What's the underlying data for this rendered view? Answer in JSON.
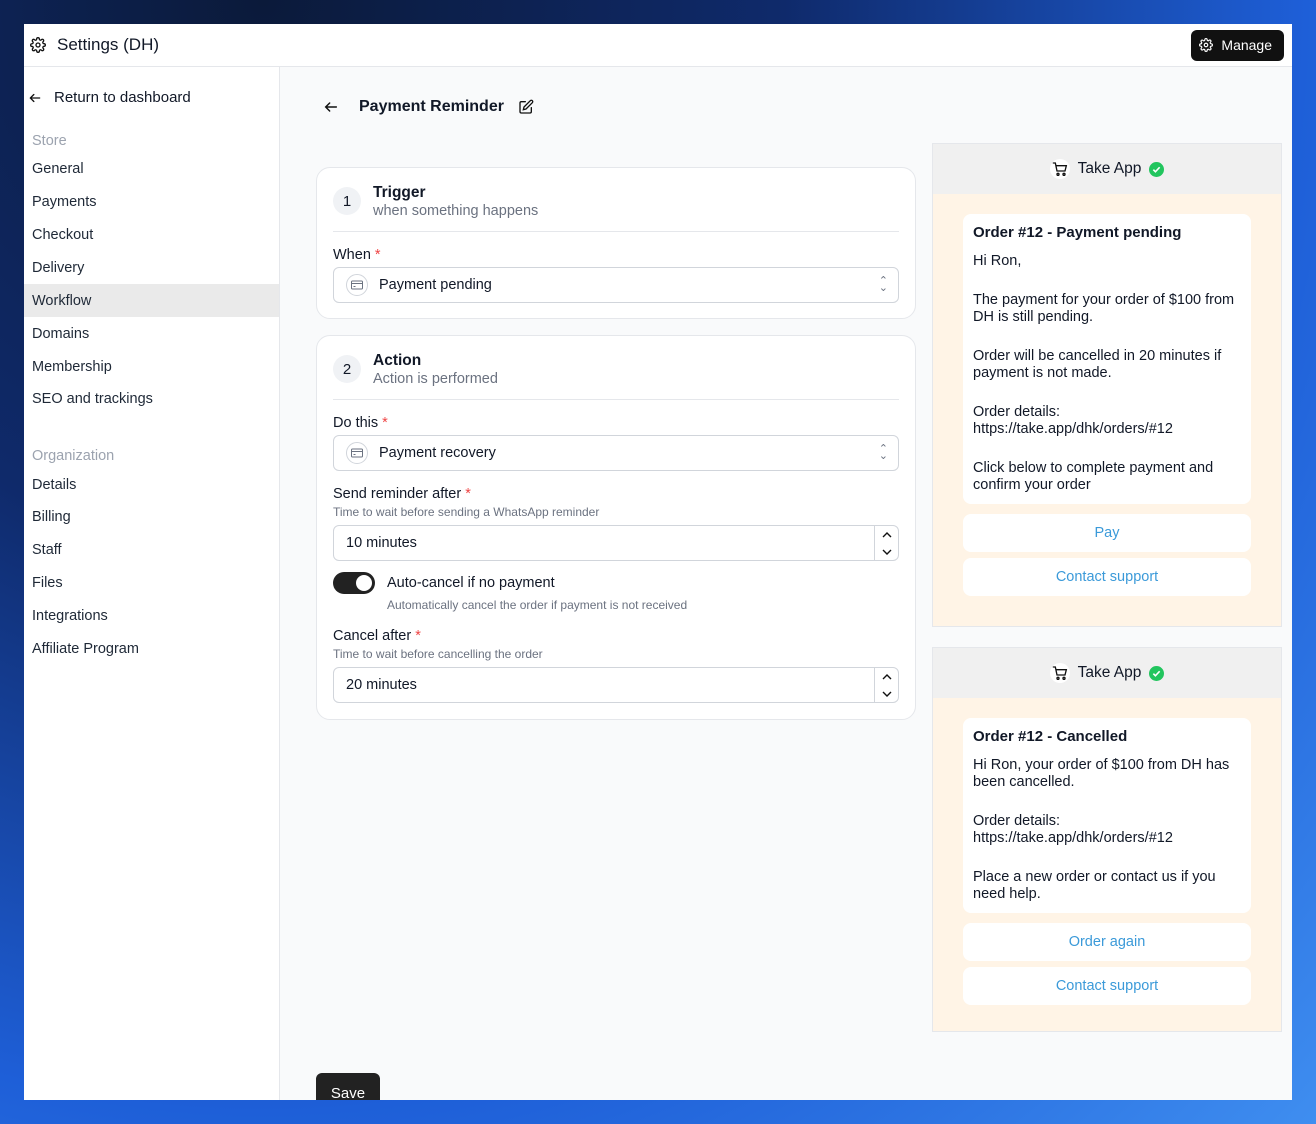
{
  "topbar": {
    "title": "Settings (DH)",
    "manage_label": "Manage"
  },
  "sidebar": {
    "back_label": "Return to dashboard",
    "store_section": "Store",
    "store_items": [
      "General",
      "Payments",
      "Checkout",
      "Delivery",
      "Workflow",
      "Domains",
      "Membership",
      "SEO and trackings"
    ],
    "active_item": "Workflow",
    "org_section": "Organization",
    "org_items": [
      "Details",
      "Billing",
      "Staff",
      "Files",
      "Integrations",
      "Affiliate Program"
    ]
  },
  "page": {
    "title": "Payment Reminder",
    "save_label": "Save"
  },
  "trigger": {
    "number": "1",
    "title": "Trigger",
    "subtitle": "when something happens",
    "when_label": "When",
    "when_value": "Payment pending"
  },
  "action": {
    "number": "2",
    "title": "Action",
    "subtitle": "Action is performed",
    "do_label": "Do this",
    "do_value": "Payment recovery",
    "reminder_label": "Send reminder after",
    "reminder_help": "Time to wait before sending a WhatsApp reminder",
    "reminder_value": "10 minutes",
    "autocancel_label": "Auto-cancel if no payment",
    "autocancel_help": "Automatically cancel the order if payment is not received",
    "autocancel_on": true,
    "cancel_label": "Cancel after",
    "cancel_help": "Time to wait before cancelling the order",
    "cancel_value": "20 minutes"
  },
  "preview1": {
    "sender": "Take App",
    "title": "Order #12 - Payment pending",
    "lines": [
      "Hi Ron,",
      "The payment for your order of $100 from DH is still pending.",
      "Order will be cancelled in 20 minutes if payment is not made.",
      "Order details: https://take.app/dhk/orders/#12",
      "Click below to complete payment and confirm your order"
    ],
    "buttons": [
      "Pay",
      "Contact support"
    ]
  },
  "preview2": {
    "sender": "Take App",
    "title": "Order #12 - Cancelled",
    "lines": [
      "Hi Ron, your order of $100 from DH has been cancelled.",
      "Order details: https://take.app/dhk/orders/#12",
      "Place a new order or contact us if you need help."
    ],
    "buttons": [
      "Order again",
      "Contact support"
    ]
  },
  "colors": {
    "accent_link": "#3b9ad9",
    "preview_bg": "#fff4e6",
    "required": "#ef4444",
    "verified": "#22c55e"
  }
}
